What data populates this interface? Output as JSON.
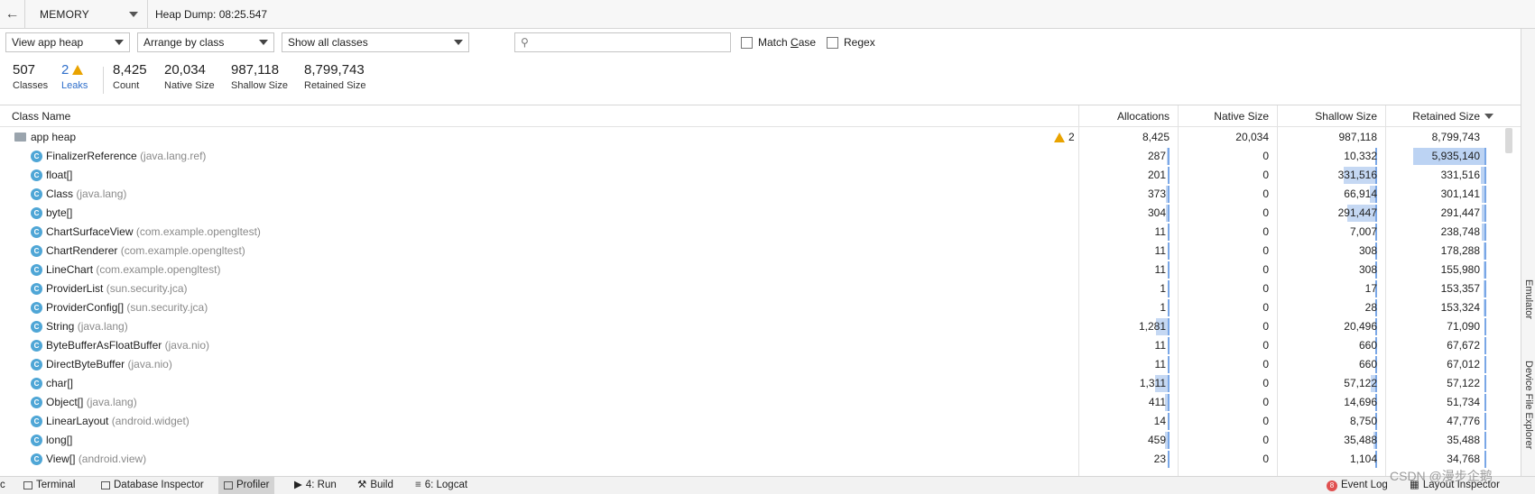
{
  "topbar": {
    "back_icon": "back-arrow-icon",
    "memory_label": "MEMORY",
    "heap_dump_label": "Heap Dump: 08:25.547"
  },
  "controls": {
    "heap_select": "View app heap",
    "arrange_select": "Arrange by class",
    "filter_select": "Show all classes",
    "search_placeholder": "",
    "match_case_pre": "Match ",
    "match_case_u": "C",
    "match_case_post": "ase",
    "regex_label": "Regex"
  },
  "summary": {
    "classes": {
      "value": "507",
      "label": "Classes"
    },
    "leaks": {
      "value": "2",
      "label": "Leaks"
    },
    "count": {
      "value": "8,425",
      "label": "Count"
    },
    "native": {
      "value": "20,034",
      "label": "Native Size"
    },
    "shallow": {
      "value": "987,118",
      "label": "Shallow Size"
    },
    "retained": {
      "value": "8,799,743",
      "label": "Retained Size"
    }
  },
  "table": {
    "headers": {
      "class_name": "Class Name",
      "allocations": "Allocations",
      "native_size": "Native Size",
      "shallow_size": "Shallow Size",
      "retained_size": "Retained Size"
    },
    "root": {
      "name": "app heap",
      "leaks": "2",
      "allocations": "8,425",
      "native": "20,034",
      "shallow": "987,118",
      "retained": "8,799,743"
    },
    "rows": [
      {
        "name": "FinalizerReference",
        "pkg": "(java.lang.ref)",
        "allocations": "287",
        "native": "0",
        "shallow": "10,332",
        "retained": "5,935,140",
        "alloc_frac": 0.03,
        "shallow_frac": 0.01,
        "retained_frac": 0.67
      },
      {
        "name": "float[]",
        "pkg": "",
        "allocations": "201",
        "native": "0",
        "shallow": "331,516",
        "retained": "331,516",
        "alloc_frac": 0.02,
        "shallow_frac": 0.34,
        "retained_frac": 0.04
      },
      {
        "name": "Class",
        "pkg": "(java.lang)",
        "allocations": "373",
        "native": "0",
        "shallow": "66,914",
        "retained": "301,141",
        "alloc_frac": 0.04,
        "shallow_frac": 0.07,
        "retained_frac": 0.03
      },
      {
        "name": "byte[]",
        "pkg": "",
        "allocations": "304",
        "native": "0",
        "shallow": "291,447",
        "retained": "291,447",
        "alloc_frac": 0.04,
        "shallow_frac": 0.3,
        "retained_frac": 0.03
      },
      {
        "name": "ChartSurfaceView",
        "pkg": "(com.example.opengltest)",
        "allocations": "11",
        "native": "0",
        "shallow": "7,007",
        "retained": "238,748",
        "alloc_frac": 0,
        "shallow_frac": 0.01,
        "retained_frac": 0.03
      },
      {
        "name": "ChartRenderer",
        "pkg": "(com.example.opengltest)",
        "allocations": "11",
        "native": "0",
        "shallow": "308",
        "retained": "178,288",
        "alloc_frac": 0,
        "shallow_frac": 0,
        "retained_frac": 0.02
      },
      {
        "name": "LineChart",
        "pkg": "(com.example.opengltest)",
        "allocations": "11",
        "native": "0",
        "shallow": "308",
        "retained": "155,980",
        "alloc_frac": 0,
        "shallow_frac": 0,
        "retained_frac": 0.02
      },
      {
        "name": "ProviderList",
        "pkg": "(sun.security.jca)",
        "allocations": "1",
        "native": "0",
        "shallow": "17",
        "retained": "153,357",
        "alloc_frac": 0,
        "shallow_frac": 0,
        "retained_frac": 0.02
      },
      {
        "name": "ProviderConfig[]",
        "pkg": "(sun.security.jca)",
        "allocations": "1",
        "native": "0",
        "shallow": "28",
        "retained": "153,324",
        "alloc_frac": 0,
        "shallow_frac": 0,
        "retained_frac": 0.02
      },
      {
        "name": "String",
        "pkg": "(java.lang)",
        "allocations": "1,281",
        "native": "0",
        "shallow": "20,496",
        "retained": "71,090",
        "alloc_frac": 0.15,
        "shallow_frac": 0.02,
        "retained_frac": 0.01
      },
      {
        "name": "ByteBufferAsFloatBuffer",
        "pkg": "(java.nio)",
        "allocations": "11",
        "native": "0",
        "shallow": "660",
        "retained": "67,672",
        "alloc_frac": 0,
        "shallow_frac": 0,
        "retained_frac": 0.01
      },
      {
        "name": "DirectByteBuffer",
        "pkg": "(java.nio)",
        "allocations": "11",
        "native": "0",
        "shallow": "660",
        "retained": "67,012",
        "alloc_frac": 0,
        "shallow_frac": 0,
        "retained_frac": 0.01
      },
      {
        "name": "char[]",
        "pkg": "",
        "allocations": "1,311",
        "native": "0",
        "shallow": "57,122",
        "retained": "57,122",
        "alloc_frac": 0.16,
        "shallow_frac": 0.06,
        "retained_frac": 0.01
      },
      {
        "name": "Object[]",
        "pkg": "(java.lang)",
        "allocations": "411",
        "native": "0",
        "shallow": "14,696",
        "retained": "51,734",
        "alloc_frac": 0.05,
        "shallow_frac": 0.01,
        "retained_frac": 0.01
      },
      {
        "name": "LinearLayout",
        "pkg": "(android.widget)",
        "allocations": "14",
        "native": "0",
        "shallow": "8,750",
        "retained": "47,776",
        "alloc_frac": 0,
        "shallow_frac": 0.01,
        "retained_frac": 0.01
      },
      {
        "name": "long[]",
        "pkg": "",
        "allocations": "459",
        "native": "0",
        "shallow": "35,488",
        "retained": "35,488",
        "alloc_frac": 0.05,
        "shallow_frac": 0.04,
        "retained_frac": 0
      },
      {
        "name": "View[]",
        "pkg": "(android.view)",
        "allocations": "23",
        "native": "0",
        "shallow": "1,104",
        "retained": "34,768",
        "alloc_frac": 0,
        "shallow_frac": 0,
        "retained_frac": 0
      }
    ]
  },
  "sidebar": {
    "emulator": "Emulator",
    "device_file_explorer": "Device File Explorer"
  },
  "bottombar": {
    "c": "c",
    "terminal": "Terminal",
    "database_inspector": "Database Inspector",
    "profiler": "Profiler",
    "run": "4: Run",
    "build": "Build",
    "logcat": "6: Logcat",
    "event_log_badge": "8",
    "event_log": "Event Log",
    "layout_inspector": "Layout Inspector"
  },
  "watermark": "CSDN @漫步企鹅"
}
